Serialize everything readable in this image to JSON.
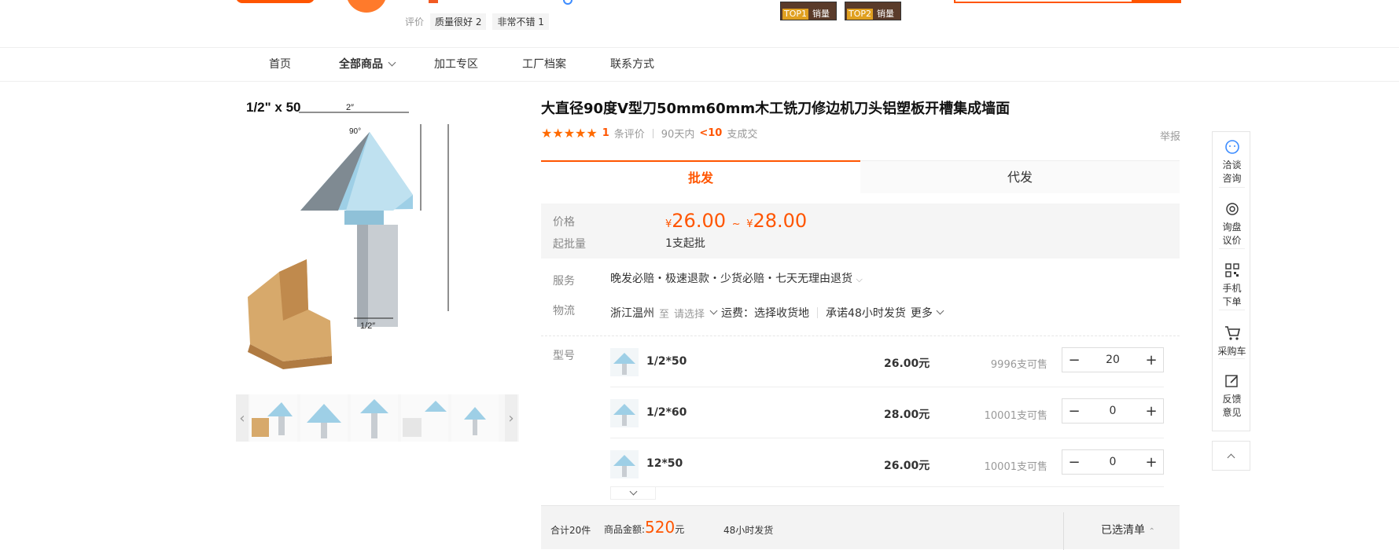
{
  "header": {
    "review_label": "评价",
    "review_tags": [
      "质量很好 2",
      "非常不错 1"
    ],
    "top_badges": [
      {
        "rank": "TOP1",
        "label": "销量"
      },
      {
        "rank": "TOP2",
        "label": "销量"
      }
    ]
  },
  "nav": {
    "items": [
      "首页",
      "全部商品",
      "加工专区",
      "工厂档案",
      "联系方式"
    ]
  },
  "product": {
    "image_caption": "1/2\" x 50",
    "title": "大直径90度V型刀50mm60mm木工铣刀修边机刀头铝塑板开槽集成墙面",
    "review_count": "1",
    "review_text": "条评价",
    "sales_prefix": "90天内",
    "sales_value": "<10",
    "sales_suffix": "支成交",
    "report": "举报",
    "rating_stars": 5
  },
  "tabs": [
    "批发",
    "代发"
  ],
  "price": {
    "label": "价格",
    "currency": "¥",
    "low": "26.00",
    "tilde": "~",
    "high": "28.00",
    "moq_label": "起批量",
    "moq_value": "1支起批"
  },
  "service": {
    "label": "服务",
    "text": "晚发必赔・极速退款・少货必赔・七天无理由退货"
  },
  "logistics": {
    "label": "物流",
    "origin": "浙江温州",
    "to": "至",
    "dest": "请选择",
    "fee": "运费：选择收货地",
    "promise": "承诺48小时发货",
    "more": "更多"
  },
  "sku": {
    "label": "型号",
    "rows": [
      {
        "name": "1/2*50",
        "price": "26.00元",
        "stock": "9996支可售",
        "qty": "20"
      },
      {
        "name": "1/2*60",
        "price": "28.00元",
        "stock": "10001支可售",
        "qty": "0"
      },
      {
        "name": "12*50",
        "price": "26.00元",
        "stock": "10001支可售",
        "qty": "0"
      }
    ]
  },
  "footer": {
    "total": "合计20件",
    "amount_label": "商品金额:",
    "amount": "520",
    "amount_unit": "元",
    "ship": "48小时发货",
    "selected_list": "已选清单"
  },
  "sidebar": {
    "items": [
      {
        "label": "洽谈\n咨询",
        "icon": "chat-icon"
      },
      {
        "label": "询盘\n议价",
        "icon": "inquiry-icon"
      },
      {
        "label": "手机\n下单",
        "icon": "qrcode-icon"
      },
      {
        "label": "采购车",
        "icon": "cart-icon"
      },
      {
        "label": "反馈\n意见",
        "icon": "edit-icon"
      }
    ]
  },
  "colors": {
    "accent": "#ff5500",
    "text": "#333333",
    "muted": "#999999"
  }
}
